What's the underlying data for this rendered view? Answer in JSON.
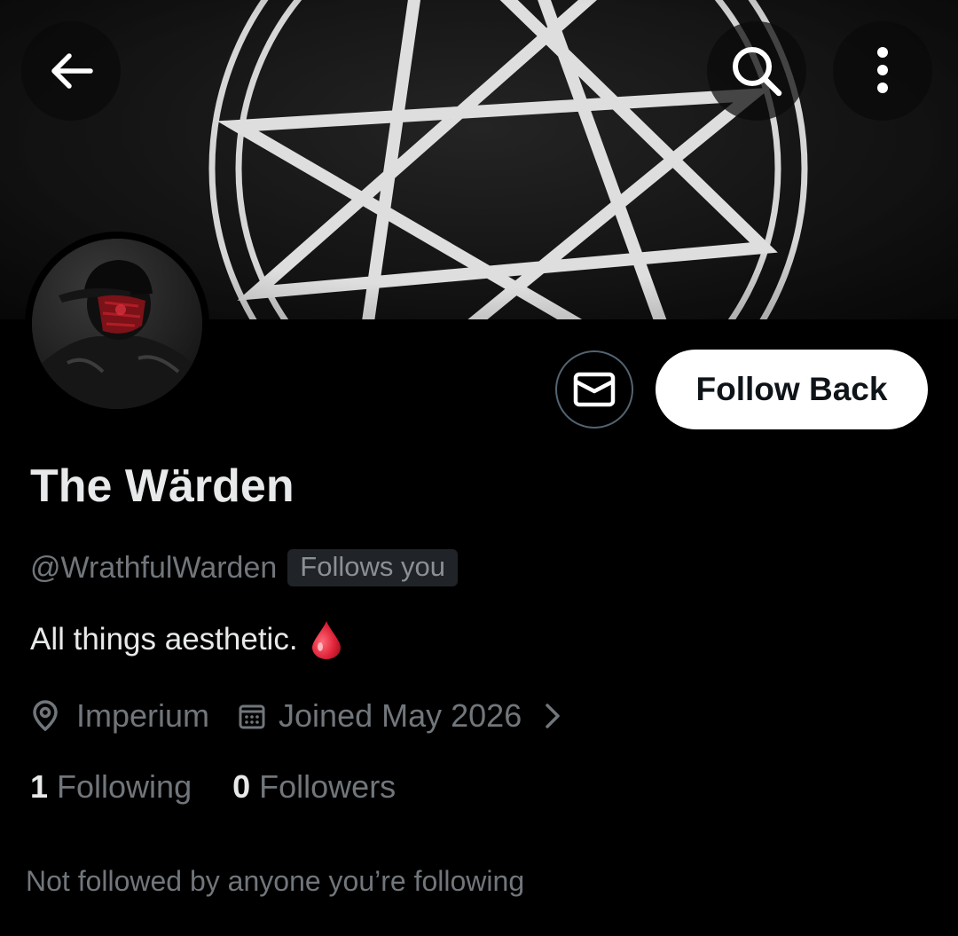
{
  "header": {
    "back_icon": "arrow-left-icon",
    "search_icon": "search-icon",
    "more_icon": "more-vertical-icon"
  },
  "banner": {
    "description_icon": "nine-pointed-star-in-circle",
    "stroke_color": "#d9d9d9"
  },
  "profile": {
    "display_name": "The Wärden",
    "handle": "@WrathfulWarden",
    "follows_you_badge": "Follows you",
    "bio": "All things aesthetic.",
    "bio_emoji": "drop-of-blood-icon",
    "location": "Imperium",
    "joined": "Joined May 2026",
    "following_count": "1",
    "following_label": "Following",
    "followers_count": "0",
    "followers_label": "Followers",
    "mutuals_note": "Not followed by anyone you’re following"
  },
  "actions": {
    "follow_label": "Follow Back",
    "message_icon": "envelope-icon"
  },
  "colors": {
    "background": "#000000",
    "primary_text": "#e7e9ea",
    "secondary_text": "#71767b",
    "button_bg": "#ffffff",
    "button_text": "#0f1419",
    "badge_bg": "#202327",
    "blood_red": "#e0243a"
  }
}
